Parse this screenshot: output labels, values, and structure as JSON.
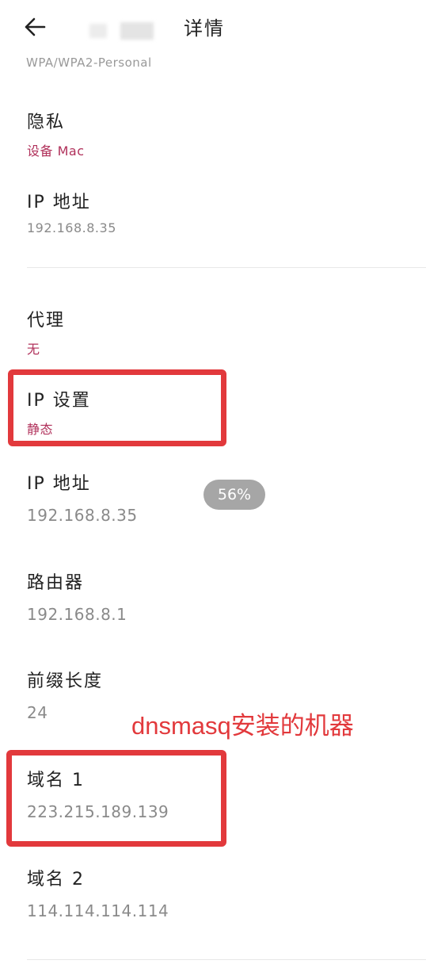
{
  "header": {
    "title": "详情",
    "back_icon": "arrow-left-icon"
  },
  "truncated_security": "WPA/WPA2-Personal",
  "privacy": {
    "label": "隐私",
    "value": "设备 Mac"
  },
  "ip_address_1": {
    "label": "IP 地址",
    "value": "192.168.8.35"
  },
  "proxy": {
    "label": "代理",
    "value": "无"
  },
  "ip_settings": {
    "label": "IP 设置",
    "value": "静态"
  },
  "ip_address_2": {
    "label": "IP 地址",
    "value": "192.168.8.35"
  },
  "router": {
    "label": "路由器",
    "value": "192.168.8.1"
  },
  "prefix_length": {
    "label": "前缀长度",
    "value": "24"
  },
  "dns1": {
    "label": "域名 1",
    "value": "223.215.189.139"
  },
  "dns2": {
    "label": "域名 2",
    "value": "114.114.114.114"
  },
  "zoom_level": "56%",
  "annotation": "dnsmasq安装的机器",
  "colors": {
    "accent": "#b0305a",
    "highlight": "#e2393c"
  }
}
